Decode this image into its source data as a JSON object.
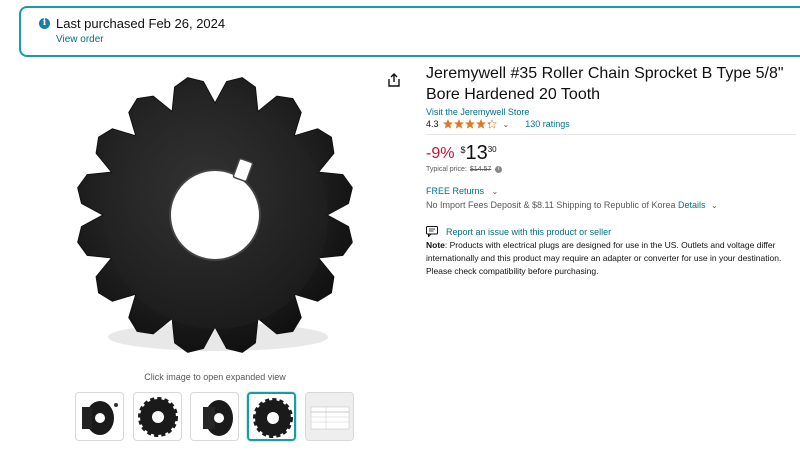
{
  "banner": {
    "purchased_text": "Last purchased Feb 26, 2024",
    "view_order_label": "View order",
    "icon": "info-icon"
  },
  "gallery": {
    "caption": "Click image to open expanded view",
    "thumbnails": [
      "sprocket-side-view",
      "sprocket-front-view",
      "sprocket-angled-view",
      "sprocket-front-view-selected",
      "dimension-table"
    ],
    "selected_index": 3
  },
  "product": {
    "title": "Jeremywell #35 Roller Chain Sprocket B Type 5/8\" Bore Hardened 20 Tooth",
    "store_link": "Visit the Jeremywell Store",
    "rating_value": "4.3",
    "stars": 4.3,
    "ratings_count": "130 ratings",
    "discount": "-9%",
    "currency_symbol": "$",
    "price_whole": "13",
    "price_fraction": "30",
    "typical_label": "Typical price:",
    "typical_price": "$14.57",
    "free_returns": "FREE Returns",
    "shipping_text": "No Import Fees Deposit & $8.11 Shipping to Republic of Korea",
    "shipping_details": "Details",
    "report_issue": "Report an issue with this product or seller",
    "note_label": "Note",
    "note_text": ": Products with electrical plugs are designed for use in the US. Outlets and voltage differ internationally and this product may require an adapter or converter for use in your destination. Please check compatibility before purchasing."
  },
  "colors": {
    "accent": "#1b9aaa",
    "link": "#007185",
    "discount": "#cc0c39",
    "star": "#de7921"
  }
}
